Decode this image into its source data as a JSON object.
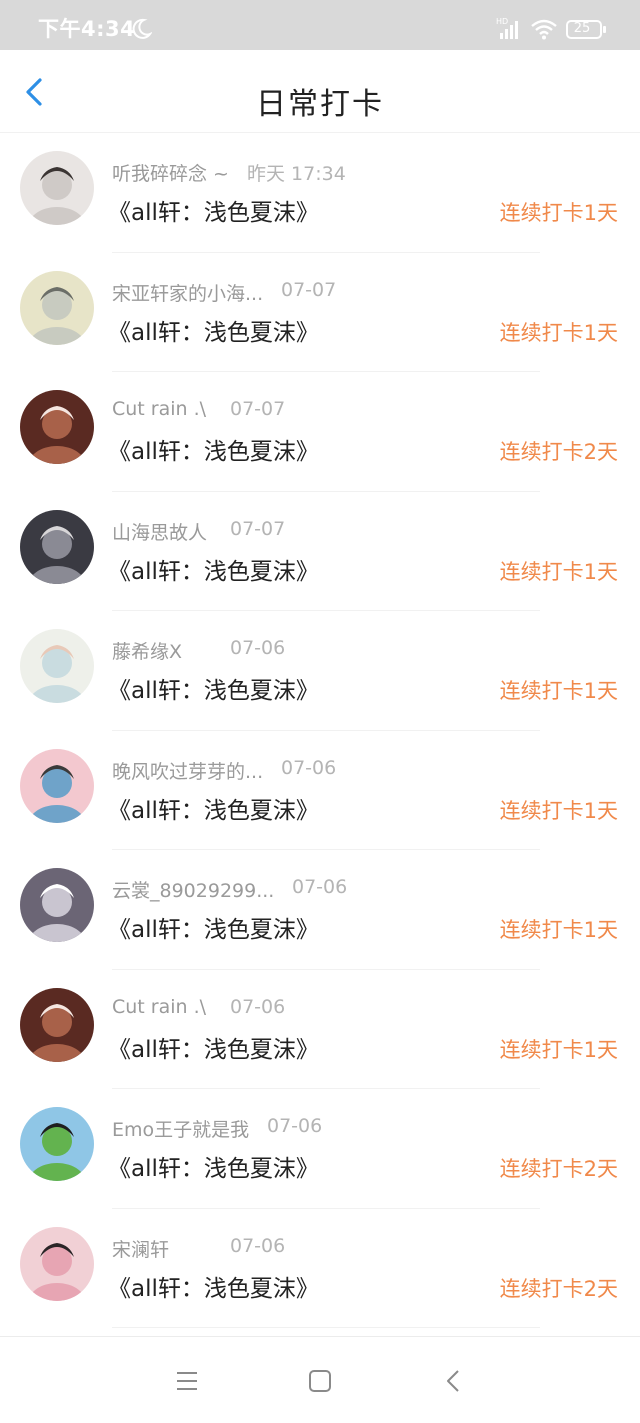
{
  "status_bar": {
    "time": "下午4:34",
    "battery": "25",
    "icons": [
      "moon-icon",
      "hd-signal-icon",
      "wifi-icon",
      "battery-icon"
    ]
  },
  "header": {
    "title": "日常打卡",
    "back_icon": "chevron-left-icon",
    "accent_color": "#2e8fe6"
  },
  "streak_color": "#f0894a",
  "checkins": [
    {
      "user": "听我碎碎念 ~",
      "time": "昨天 17:34",
      "book": "《all轩：浅色夏沫》",
      "streak": "连续打卡1天",
      "avatar_colors": [
        "#e9e5e3",
        "#cfcac7",
        "#3b3533"
      ]
    },
    {
      "user": "宋亚轩家的小海...",
      "time": "07-07",
      "book": "《all轩：浅色夏沫》",
      "streak": "连续打卡1天",
      "avatar_colors": [
        "#e7e4c8",
        "#c8cbc0",
        "#6b6e68"
      ]
    },
    {
      "user": "Cut rain .\\",
      "time": "07-07",
      "book": "《all轩：浅色夏沫》",
      "streak": "连续打卡2天",
      "avatar_colors": [
        "#5a2a22",
        "#a86149",
        "#f5e6e0"
      ]
    },
    {
      "user": "山海思故人",
      "time": "07-07",
      "book": "《all轩：浅色夏沫》",
      "streak": "连续打卡1天",
      "avatar_colors": [
        "#3a3a42",
        "#8a8a94",
        "#d8d6d8"
      ]
    },
    {
      "user": "藤希缘X",
      "time": "07-06",
      "book": "《all轩：浅色夏沫》",
      "streak": "连续打卡1天",
      "avatar_colors": [
        "#eef0ea",
        "#c9dce0",
        "#e8c9b8"
      ]
    },
    {
      "user": "晚风吹过芽芽的...",
      "time": "07-06",
      "book": "《all轩：浅色夏沫》",
      "streak": "连续打卡1天",
      "avatar_colors": [
        "#f3c8cf",
        "#6fa3c9",
        "#3b3b3b"
      ]
    },
    {
      "user": "云裳_89029299...",
      "time": "07-06",
      "book": "《all轩：浅色夏沫》",
      "streak": "连续打卡1天",
      "avatar_colors": [
        "#6b6575",
        "#c9c5d0",
        "#ffffff"
      ]
    },
    {
      "user": "Cut rain .\\",
      "time": "07-06",
      "book": "《all轩：浅色夏沫》",
      "streak": "连续打卡1天",
      "avatar_colors": [
        "#5a2a22",
        "#a86149",
        "#f5e6e0"
      ]
    },
    {
      "user": "Emo王子就是我",
      "time": "07-06",
      "book": "《all轩：浅色夏沫》",
      "streak": "连续打卡2天",
      "avatar_colors": [
        "#8fc6e6",
        "#63b34f",
        "#1f1f1f"
      ]
    },
    {
      "user": "宋澜轩",
      "time": "07-06",
      "book": "《all轩：浅色夏沫》",
      "streak": "连续打卡2天",
      "avatar_colors": [
        "#f1d0d5",
        "#e7a5b3",
        "#2b2527"
      ]
    }
  ],
  "nav_bar": {
    "icons": [
      "menu-icon",
      "home-square-icon",
      "back-triangle-icon"
    ]
  }
}
